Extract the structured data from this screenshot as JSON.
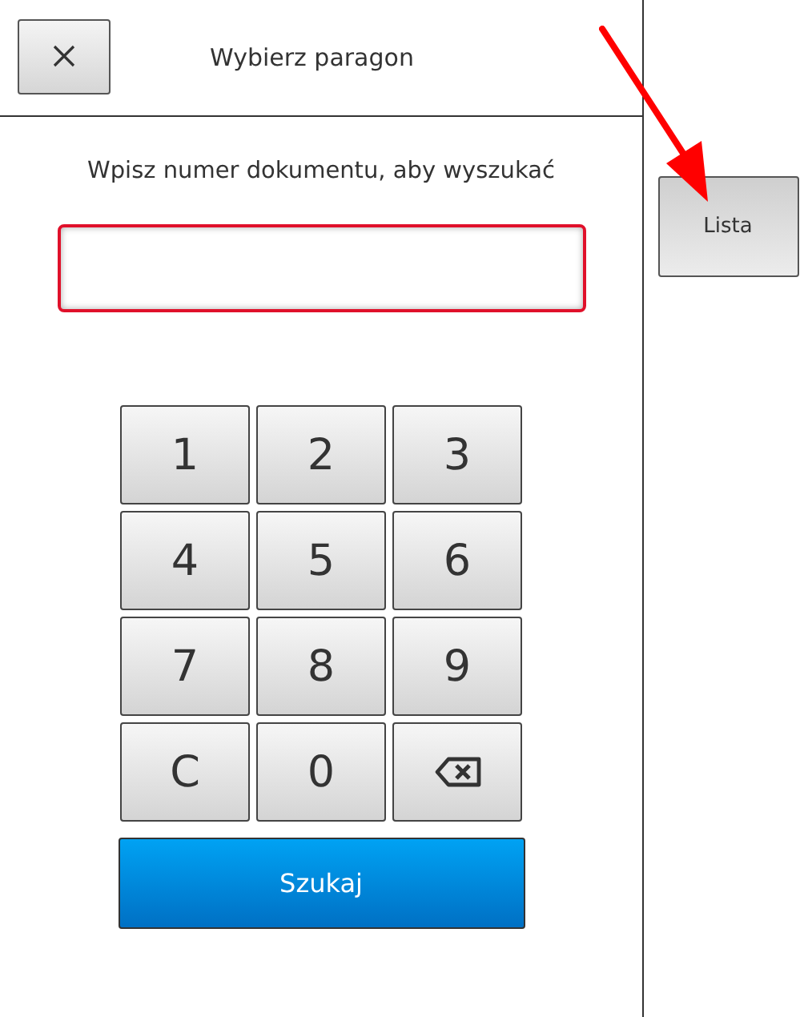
{
  "header": {
    "title": "Wybierz paragon"
  },
  "prompt": "Wpisz numer dokumentu, aby wyszukać",
  "document_field": {
    "invalid": true
  },
  "keypad": [
    {
      "kind": "key",
      "label": "1"
    },
    {
      "kind": "key",
      "label": "2"
    },
    {
      "kind": "key",
      "label": "3"
    },
    {
      "kind": "key",
      "label": "4"
    },
    {
      "kind": "key",
      "label": "5"
    },
    {
      "kind": "key",
      "label": "6"
    },
    {
      "kind": "key",
      "label": "7"
    },
    {
      "kind": "key",
      "label": "8"
    },
    {
      "kind": "key",
      "label": "9"
    },
    {
      "kind": "key",
      "label": "C"
    },
    {
      "kind": "key",
      "label": "0"
    },
    {
      "kind": "backspace"
    }
  ],
  "search_button": "Szukaj",
  "side_buttons": [
    "Lista"
  ]
}
